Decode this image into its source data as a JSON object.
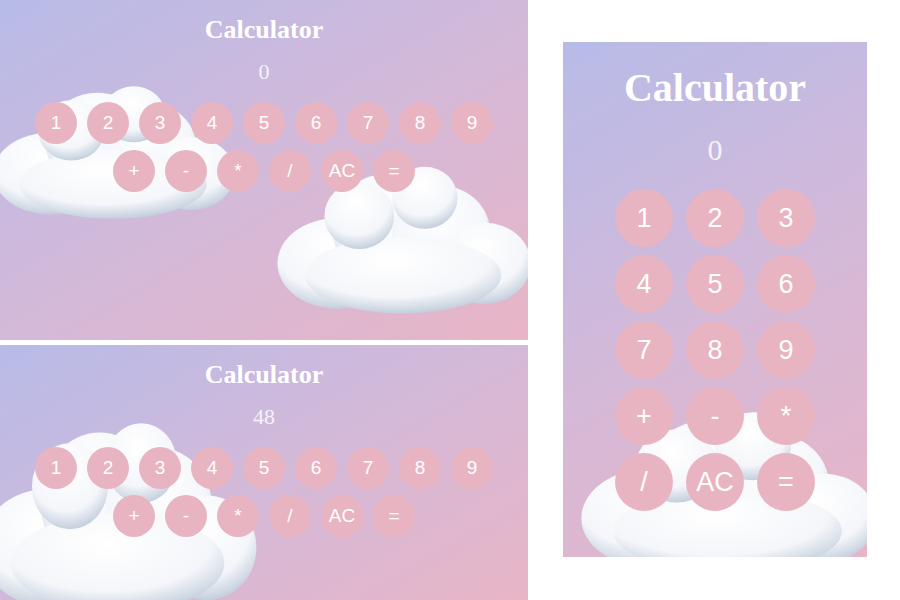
{
  "views": [
    {
      "kind": "wide",
      "title": "Calculator",
      "display": "0",
      "keys": [
        "1",
        "2",
        "3",
        "4",
        "5",
        "6",
        "7",
        "8",
        "9",
        "+",
        "-",
        "*",
        "/",
        "AC",
        "="
      ]
    },
    {
      "kind": "wide",
      "title": "Calculator",
      "display": "48",
      "keys": [
        "1",
        "2",
        "3",
        "4",
        "5",
        "6",
        "7",
        "8",
        "9",
        "+",
        "-",
        "*",
        "/",
        "AC",
        "="
      ]
    },
    {
      "kind": "tall",
      "title": "Calculator",
      "display": "0",
      "keys": [
        "1",
        "2",
        "3",
        "4",
        "5",
        "6",
        "7",
        "8",
        "9",
        "+",
        "-",
        "*",
        "/",
        "AC",
        "="
      ]
    }
  ]
}
